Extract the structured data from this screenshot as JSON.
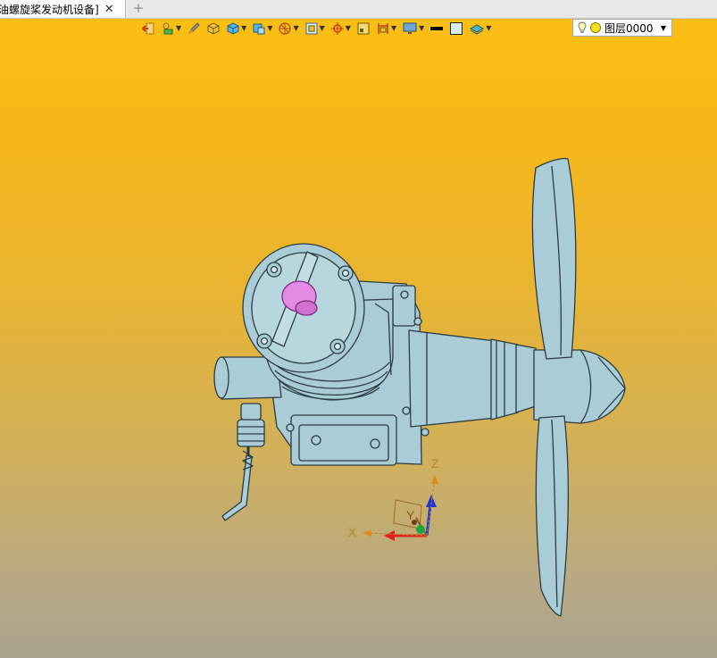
{
  "tab": {
    "title": "油螺旋桨发动机设备]",
    "close_symbol": "✕",
    "add_symbol": "+"
  },
  "toolbar": {
    "buttons": [
      {
        "name": "exit-icon"
      },
      {
        "name": "shape-tools-icon"
      },
      {
        "name": "brush-icon"
      },
      {
        "name": "shaded-solid-icon"
      },
      {
        "name": "display-mode-icon"
      },
      {
        "name": "view-cube-icon"
      },
      {
        "name": "view-orientation-icon"
      },
      {
        "name": "zoom-window-icon"
      },
      {
        "name": "snap-target-icon"
      },
      {
        "name": "frame-icon"
      },
      {
        "name": "section-icon"
      },
      {
        "name": "monitor-icon"
      },
      {
        "name": "line-color-icon"
      },
      {
        "name": "fill-color-icon"
      },
      {
        "name": "layer-stack-icon"
      }
    ],
    "layer_value": "图层0000"
  },
  "axes": {
    "x_label": "X",
    "y_label": "Y",
    "z_label": "Z"
  },
  "colors": {
    "model_body": "#a9ccd6",
    "model_edge": "#2b3c44",
    "highlight_part": "#e48ae4",
    "bg_top": "#fcbf12",
    "bg_bottom": "#aba38f"
  }
}
